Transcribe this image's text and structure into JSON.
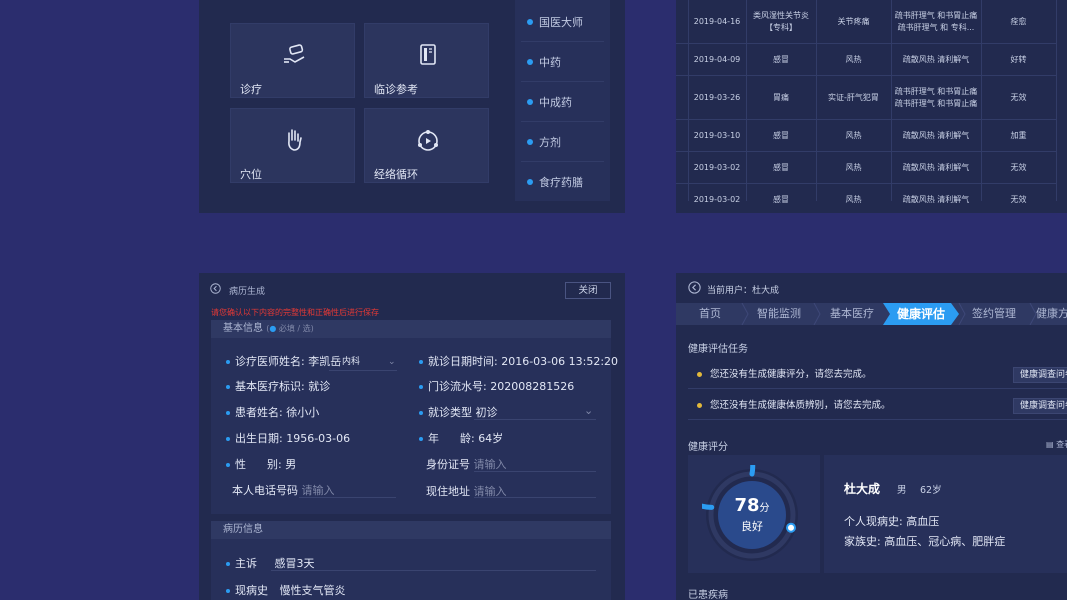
{
  "menu_panel": {
    "tiles": [
      "诊疗",
      "临诊参考",
      "穴位",
      "经络循环"
    ],
    "side_items": [
      "国医大师",
      "中药",
      "中成药",
      "方剂",
      "食疗药膳"
    ]
  },
  "records_table": {
    "rows": [
      {
        "date": "2019-04-16",
        "diagnosis": "类风湿性关节炎\n【专科】",
        "syndrome": "关节疼痛",
        "method": "疏书肝理气 和书胃止痛\n疏书肝理气 和 专科...",
        "result": "痊愈"
      },
      {
        "date": "2019-04-09",
        "diagnosis": "感冒",
        "syndrome": "风热",
        "method": "疏散风热 清利解气",
        "result": "好转"
      },
      {
        "date": "2019-03-26",
        "diagnosis": "胃痛",
        "syndrome": "实证-肝气犯胃",
        "method": "疏书肝理气 和书胃止痛\n疏书肝理气 和书胃止痛",
        "result": "无效"
      },
      {
        "date": "2019-03-10",
        "diagnosis": "感冒",
        "syndrome": "风热",
        "method": "疏散风热 清利解气",
        "result": "加重"
      },
      {
        "date": "2019-03-02",
        "diagnosis": "感冒",
        "syndrome": "风热",
        "method": "疏散风热 清利解气",
        "result": "无效"
      },
      {
        "date": "2019-03-02",
        "diagnosis": "感冒",
        "syndrome": "风热",
        "method": "疏散风热 清利解气",
        "result": "无效"
      }
    ]
  },
  "record_form": {
    "title": "病历生成",
    "close_label": "关闭",
    "warning": "请您确认以下内容的完整性和正确性后进行保存",
    "basic_header": "基本信息",
    "required_note": "必填 / 选",
    "fields": {
      "doctor_label": "诊疗医师姓名:",
      "doctor_value": "李凯岳",
      "dept_value": "内科",
      "visit_time_label": "就诊日期时间:",
      "visit_time_value": "2016-03-06  13:52:20",
      "insurance_label": "基本医疗标识:",
      "insurance_value": "就诊",
      "serial_label": "门诊流水号:",
      "serial_value": "202008281526",
      "patient_label": "患者姓名:",
      "patient_value": "徐小小",
      "visit_type_label": "就诊类型",
      "visit_type_value": "初诊",
      "birth_label": "出生日期:",
      "birth_value": "1956-03-06",
      "age_label": "年      龄:",
      "age_value": "64岁",
      "gender_label": "性      别:",
      "gender_value": "男",
      "id_label": "身份证号",
      "id_placeholder": "请输入",
      "phone_label": "本人电话号码",
      "phone_placeholder": "请输入",
      "address_label": "现住地址",
      "address_placeholder": "请输入"
    },
    "history_header": "病历信息",
    "complaint_label": "主诉",
    "complaint_value": "感冒3天",
    "present_label": "现病史",
    "present_value": "慢性支气管炎"
  },
  "health_panel": {
    "current_user": "当前用户：杜大成",
    "tabs": [
      "首页",
      "智能监测",
      "基本医疗",
      "健康评估",
      "签约管理",
      "健康方"
    ],
    "active_tab": "健康评估",
    "task_title": "健康评估任务",
    "tasks": [
      {
        "text": "您还没有生成健康评分，请您去完成。",
        "button": "健康调查问卷"
      },
      {
        "text": "您还没有生成健康体质辨别，请您去完成。",
        "button": "健康调查问卷"
      }
    ],
    "score_title": "健康评分",
    "view_label": "查看",
    "score": "78",
    "score_unit": "分",
    "score_level": "良好",
    "score_fraction": 0.78,
    "patient_name": "杜大成",
    "patient_gender": "男",
    "patient_age": "62岁",
    "present_history": "个人现病史: 高血压",
    "family_history": "家族史: 高血压、冠心病、肥胖症",
    "disease_title": "已患疾病",
    "accent_color": "#2b9cf2"
  }
}
